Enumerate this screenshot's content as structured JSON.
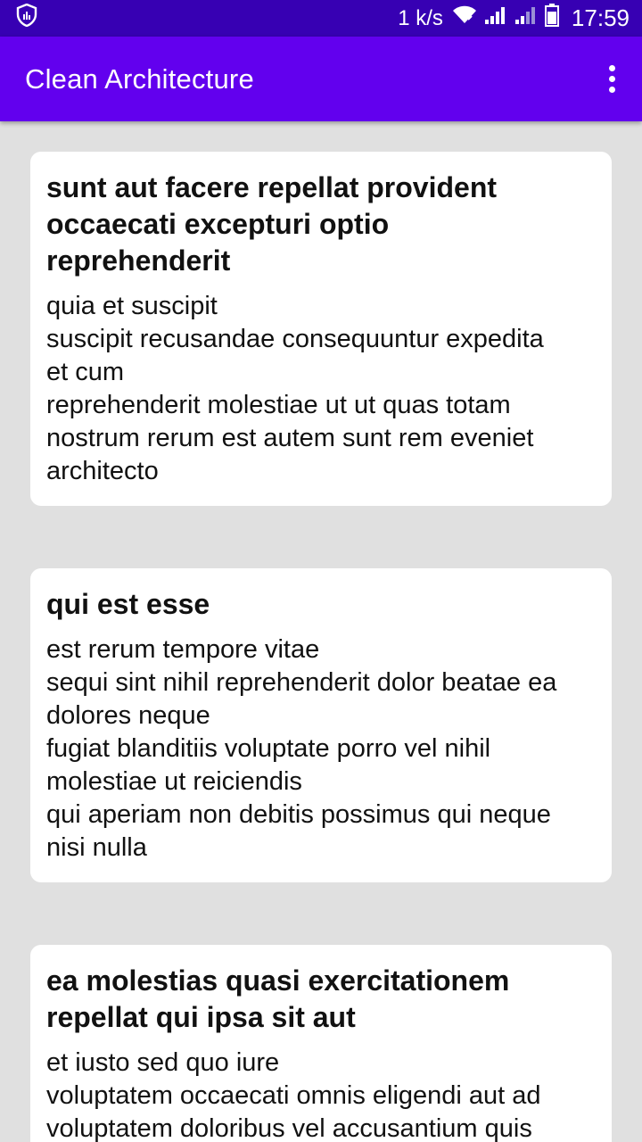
{
  "status_bar": {
    "network_speed": "1 k/s",
    "time": "17:59",
    "icons": [
      "shield-icon",
      "wifi-icon",
      "signal-icon",
      "signal-icon-2",
      "battery-icon"
    ]
  },
  "app_bar": {
    "title": "Clean Architecture",
    "menu_icon": "more-vert-icon"
  },
  "colors": {
    "status_bar": "#3700b3",
    "app_bar": "#6200ee",
    "background": "#e0e0e0",
    "card": "#ffffff"
  },
  "posts": [
    {
      "title": "sunt aut facere repellat provident\noccaecati excepturi optio\nreprehenderit",
      "body": "quia et suscipit\nsuscipit recusandae consequuntur expedita\net cum\nreprehenderit molestiae ut ut quas totam\nnostrum rerum est autem sunt rem eveniet\narchitecto"
    },
    {
      "title": "qui est esse",
      "body": "est rerum tempore vitae\nsequi sint nihil reprehenderit dolor beatae ea\ndolores neque\nfugiat blanditiis voluptate porro vel nihil\nmolestiae ut reiciendis\nqui aperiam non debitis possimus qui neque\nnisi nulla"
    },
    {
      "title": "ea molestias quasi exercitationem\nrepellat qui ipsa sit aut",
      "body": "et iusto sed quo iure\nvoluptatem occaecati omnis eligendi aut ad\nvoluptatem doloribus vel accusantium quis"
    }
  ]
}
